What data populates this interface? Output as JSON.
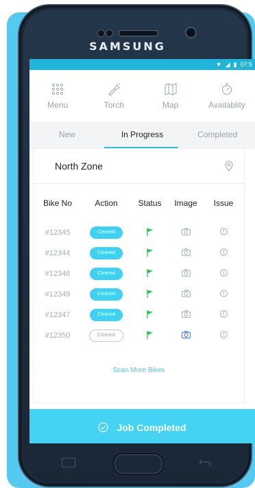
{
  "device": {
    "brand": "SAMSUNG"
  },
  "statusbar": {
    "time": "07:5"
  },
  "toolbar": {
    "items": [
      {
        "label": "Menu",
        "icon": "grid-icon"
      },
      {
        "label": "Torch",
        "icon": "torch-icon"
      },
      {
        "label": "Map",
        "icon": "map-icon"
      },
      {
        "label": "Availablity",
        "icon": "timer-icon"
      }
    ]
  },
  "tabs": [
    {
      "label": "New",
      "active": false
    },
    {
      "label": "In Progress",
      "active": true
    },
    {
      "label": "Completed",
      "active": false
    }
  ],
  "zone": {
    "title": "North Zone"
  },
  "table": {
    "headers": [
      "Bike No",
      "Action",
      "Status",
      "Image",
      "Issue"
    ],
    "rows": [
      {
        "bike": "#12345",
        "action": "Cleaned",
        "filled": true,
        "image_highlight": false
      },
      {
        "bike": "#12344",
        "action": "Cleaned",
        "filled": true,
        "image_highlight": false
      },
      {
        "bike": "#12346",
        "action": "Cleaned",
        "filled": true,
        "image_highlight": false
      },
      {
        "bike": "#12349",
        "action": "Cleaned",
        "filled": true,
        "image_highlight": false
      },
      {
        "bike": "#12347",
        "action": "Cleaned",
        "filled": true,
        "image_highlight": false
      },
      {
        "bike": "#12350",
        "action": "Cleaned",
        "filled": false,
        "image_highlight": true
      }
    ]
  },
  "scan_more": "Scan More Bikes",
  "job_completed": "Job Completed",
  "colors": {
    "accent": "#44d3f2",
    "flag": "#22c14a",
    "statusbar": "#1fb4d8"
  }
}
